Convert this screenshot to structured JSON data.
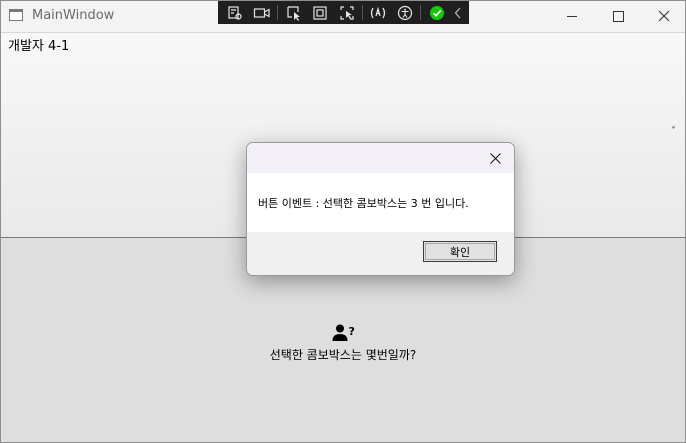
{
  "window": {
    "title": "MainWindow"
  },
  "debug_toolbar": {
    "icons": [
      "live-visual-tree-icon",
      "video-icon",
      "select-element-icon",
      "display-layout-adorners-icon",
      "track-focus-icon",
      "hot-reload-icon",
      "accessibility-icon",
      "binding-ok-icon",
      "collapse-chevron-icon"
    ],
    "status_color": "#16c60c"
  },
  "main": {
    "top_label": "개발자 4-1",
    "dropdown_glyph": "˅",
    "question": "선택한 콤보박스는 몇번일까?",
    "question_icon": "user-question-icon"
  },
  "dialog": {
    "message": "버튼 이벤트 : 선택한 콤보박스는 3 번 입니다.",
    "ok_label": "확인"
  }
}
